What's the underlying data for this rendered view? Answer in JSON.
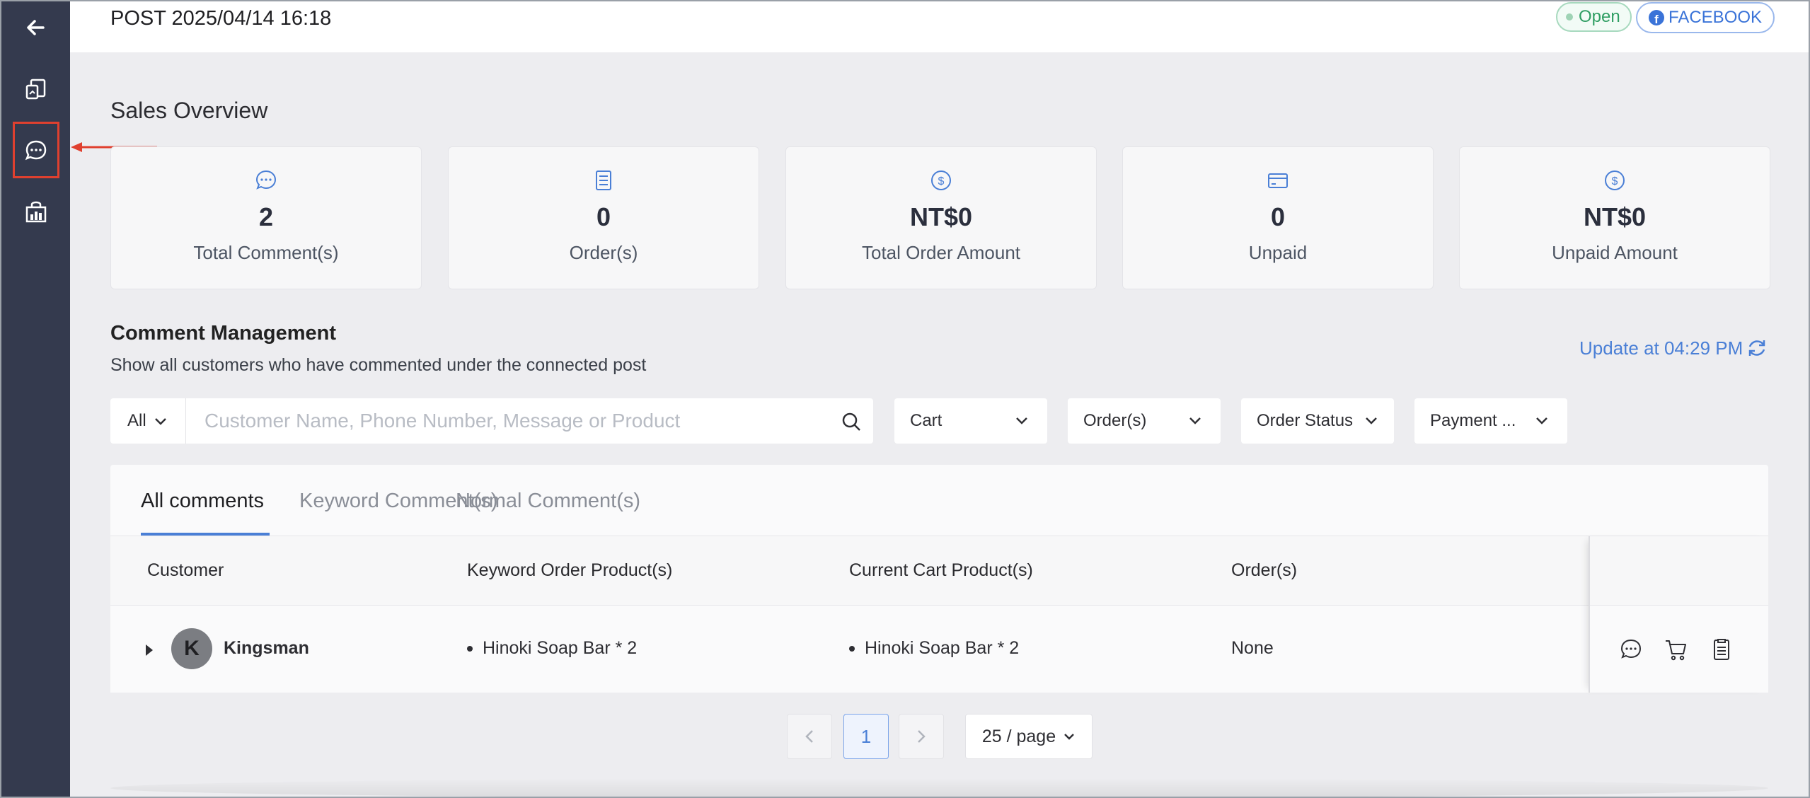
{
  "sidebar": {
    "items": [
      {
        "name": "back-arrow-icon"
      },
      {
        "name": "posts-icon"
      },
      {
        "name": "comments-icon",
        "active": true
      },
      {
        "name": "shop-icon"
      }
    ]
  },
  "header": {
    "title": "POST 2025/04/14 16:18",
    "status_badge": "Open",
    "platform_badge": "FACEBOOK"
  },
  "overview": {
    "title": "Sales Overview",
    "cards": [
      {
        "icon": "comment-icon",
        "value": "2",
        "label": "Total Comment(s)"
      },
      {
        "icon": "order-icon",
        "value": "0",
        "label": "Order(s)"
      },
      {
        "icon": "dollar-icon",
        "value": "NT$0",
        "label": "Total Order Amount"
      },
      {
        "icon": "card-icon",
        "value": "0",
        "label": "Unpaid"
      },
      {
        "icon": "dollar-icon",
        "value": "NT$0",
        "label": "Unpaid Amount"
      }
    ]
  },
  "comments": {
    "title": "Comment Management",
    "subtitle": "Show all customers who have commented under the connected post",
    "update_label": "Update at 04:29 PM",
    "filters": {
      "scope": "All",
      "search_placeholder": "Customer Name, Phone Number, Message or Product",
      "cart": "Cart",
      "orders": "Order(s)",
      "order_status": "Order Status",
      "payment": "Payment ..."
    },
    "tabs": [
      {
        "label": "All comments",
        "active": true
      },
      {
        "label": "Keyword Comment(s)",
        "active": false
      },
      {
        "label": "Normal Comment(s)",
        "active": false
      }
    ],
    "columns": [
      "Customer",
      "Keyword Order Product(s)",
      "Current Cart Product(s)",
      "Order(s)"
    ],
    "rows": [
      {
        "avatar_letter": "K",
        "customer": "Kingsman",
        "keyword_products": "Hinoki Soap Bar  * 2",
        "cart_products": "Hinoki Soap Bar  * 2",
        "orders": "None"
      }
    ]
  },
  "pagination": {
    "current_page": "1",
    "page_size": "25 / page"
  },
  "colors": {
    "sidebar": "#343a4e",
    "accent": "#4a7fd6",
    "highlight": "#e0402f",
    "open_green": "#2f9e63"
  }
}
